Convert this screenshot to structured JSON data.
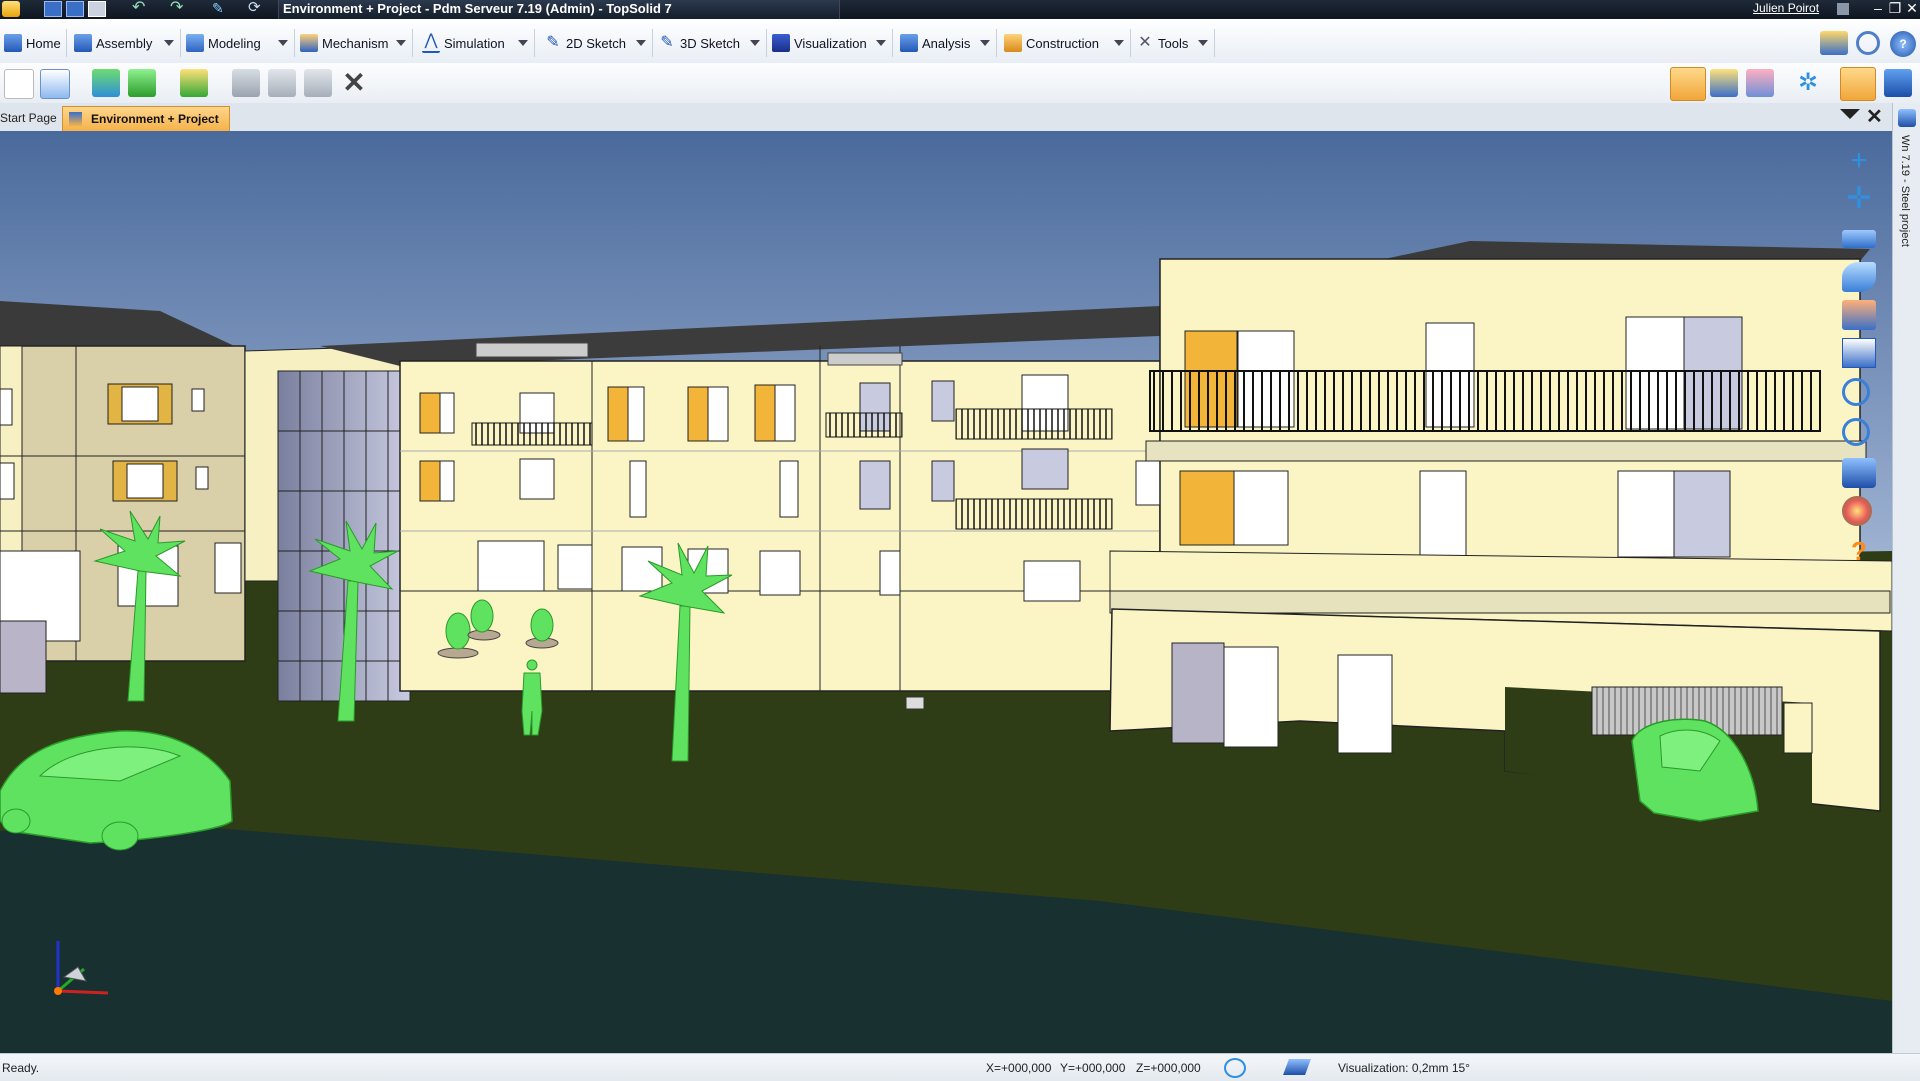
{
  "titlebar": {
    "title": "Environment + Project - Pdm Serveur 7.19 (Admin) - TopSolid 7",
    "user": "Julien Poirot",
    "quick_access_icons": [
      "app-menu-icon",
      "save-icon",
      "save-all-icon",
      "print-icon",
      "undo-icon",
      "redo-icon",
      "pen-icon",
      "refresh-icon"
    ],
    "window_controls": [
      "minimize-icon",
      "restore-icon",
      "close-icon"
    ]
  },
  "ribbon": {
    "tabs": [
      {
        "label": "Home",
        "icon": "home-icon"
      },
      {
        "label": "Assembly",
        "icon": "assembly-icon"
      },
      {
        "label": "Modeling",
        "icon": "modeling-icon"
      },
      {
        "label": "Mechanism",
        "icon": "mechanism-icon"
      },
      {
        "label": "Simulation",
        "icon": "simulation-icon"
      },
      {
        "label": "2D Sketch",
        "icon": "sketch-2d-icon"
      },
      {
        "label": "3D Sketch",
        "icon": "sketch-3d-icon"
      },
      {
        "label": "Visualization",
        "icon": "visualization-icon"
      },
      {
        "label": "Analysis",
        "icon": "analysis-icon"
      },
      {
        "label": "Construction",
        "icon": "construction-icon"
      },
      {
        "label": "Tools",
        "icon": "tools-icon"
      }
    ]
  },
  "toolbar": {
    "left_icons": [
      "new-document-icon",
      "open-document-icon",
      "check-in-icon",
      "check-out-icon",
      "update-icon",
      "cut-icon",
      "copy-icon",
      "paste-icon",
      "delete-icon"
    ],
    "right_icons": [
      "link-icon",
      "gears-icon",
      "tag-icon",
      "snap-icon",
      "display-icon",
      "monitor-icon"
    ]
  },
  "doc_tabs": {
    "start": "Start Page",
    "active": "Environment + Project"
  },
  "side_panel": {
    "label": "Wn 7.19 - Steel project"
  },
  "view_tools": [
    "add-icon",
    "move-icon",
    "camera-icon",
    "fly-icon",
    "paint-icon",
    "grid-view-icon",
    "zoom-window-icon",
    "zoom-icon",
    "box-view-icon",
    "palette-icon",
    "help-icon"
  ],
  "status": {
    "ready": "Ready.",
    "x": "X=+000,000",
    "y": "Y=+000,000",
    "z": "Z=+000,000",
    "visualization": "Visualization: 0,2mm 15°"
  },
  "colors": {
    "sky": "#4a6a9c",
    "ground": "#2f3d16",
    "road": "#183030",
    "facade": "#fbf5c6",
    "shutter": "#f2b53a",
    "vegetation": "#5fe25f",
    "active_tab": "#f4b24b"
  }
}
